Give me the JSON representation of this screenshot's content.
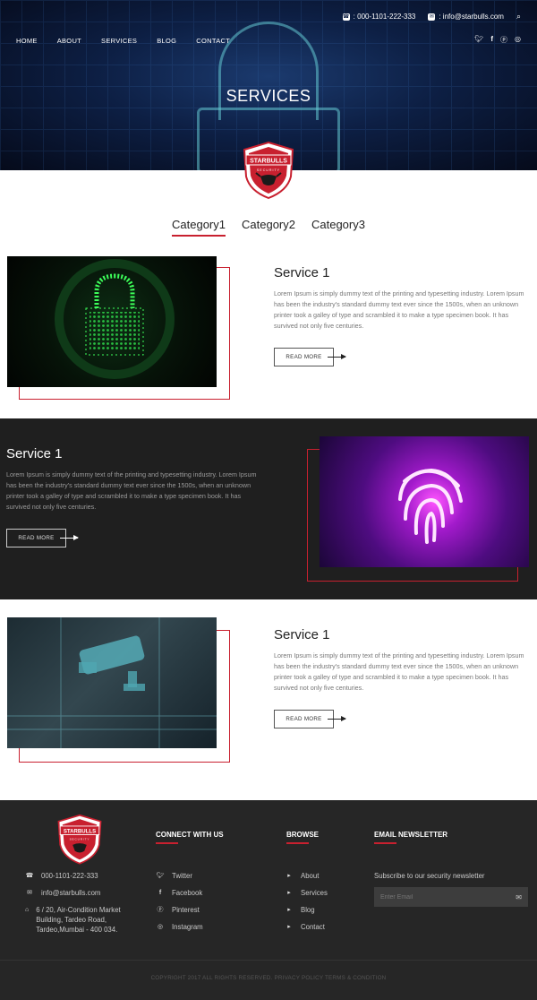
{
  "topbar": {
    "phone": ": 000-1101-222-333",
    "email": ": info@starbulls.com",
    "icons": [
      "phone-icon",
      "envelope-icon",
      "search-icon"
    ]
  },
  "nav": {
    "items": [
      "HOME",
      "ABOUT",
      "SERVICES",
      "BLOG",
      "CONTACT"
    ],
    "social_icons": [
      "twitter-icon",
      "facebook-icon",
      "pinterest-icon",
      "instagram-icon"
    ]
  },
  "hero": {
    "title": "SERVICES"
  },
  "logo": {
    "text_top": "STARBULLS",
    "text_bottom": "SECURITY"
  },
  "tabs": [
    {
      "label": "Category1",
      "active": true
    },
    {
      "label": "Category2",
      "active": false
    },
    {
      "label": "Category3",
      "active": false
    }
  ],
  "services": [
    {
      "title": "Service 1",
      "text": "Lorem Ipsum is simply dummy text of the printing and typesetting industry. Lorem Ipsum has been the industry's standard dummy text ever since the 1500s, when an unknown printer took a galley of type and scrambled it to make a type specimen book. It has survived not only five centuries.",
      "button": "READ MORE"
    },
    {
      "title": "Service 1",
      "text": "Lorem Ipsum is simply dummy text of the printing and typesetting industry. Lorem Ipsum has been the industry's standard dummy text ever since the 1500s, when an unknown printer took a galley of type and scrambled it to make a type specimen book. It has survived not only five centuries.",
      "button": "READ MORE"
    },
    {
      "title": "Service 1",
      "text": "Lorem Ipsum is simply dummy text of the printing and typesetting industry. Lorem Ipsum has been the industry's standard dummy text ever since the 1500s, when an unknown printer took a galley of type and scrambled it to make a type specimen book. It has survived not only five centuries.",
      "button": "READ MORE"
    }
  ],
  "footer": {
    "contact": {
      "phone": "000-1101-222-333",
      "email": "info@starbulls.com",
      "address": "6 / 20, Air-Condition Market Building, Tardeo Road, Tardeo,Mumbai - 400 034."
    },
    "connect": {
      "heading": "CONNECT WITH US",
      "items": [
        "Twitter",
        "Facebook",
        "Pinterest",
        "Instagram"
      ]
    },
    "browse": {
      "heading": "BROWSE",
      "items": [
        "About",
        "Services",
        "Blog",
        "Contact"
      ]
    },
    "newsletter": {
      "heading": "EMAIL NEWSLETTER",
      "subtitle": "Subscribe to our security newsletter",
      "placeholder": "Enter Email"
    },
    "copyright": "COPYRIGHT 2017 ALL RIGHTS RESERVED. PRIVACY POLICY TERMS & CONDITION"
  },
  "colors": {
    "accent": "#c8202f",
    "dark_band": "#1f1f1f",
    "footer_bg": "#262626"
  }
}
